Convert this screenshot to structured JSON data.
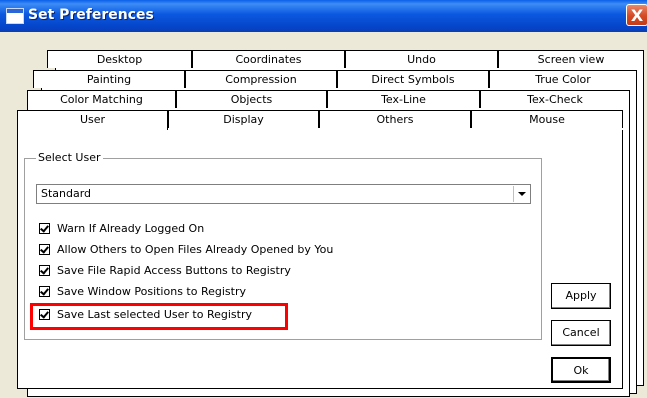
{
  "window": {
    "title": "Set Preferences",
    "close_glyph": "X",
    "icon": "window-icon"
  },
  "tabs": {
    "row1": [
      "Desktop",
      "Coordinates",
      "Undo",
      "Screen view"
    ],
    "row2": [
      "Painting",
      "Compression",
      "Direct Symbols",
      "True Color"
    ],
    "row3": [
      "Color Matching",
      "Objects",
      "Tex-Line",
      "Tex-Check"
    ],
    "row4": [
      "User",
      "Display",
      "Others",
      "Mouse"
    ],
    "active": "User"
  },
  "user_page": {
    "group_label": "Select User",
    "select": {
      "value": "Standard"
    },
    "checkboxes": [
      {
        "label": "Warn If Already Logged On",
        "checked": true
      },
      {
        "label": "Allow Others to Open Files Already Opened by You",
        "checked": true
      },
      {
        "label": "Save File Rapid Access Buttons to Registry",
        "checked": true
      },
      {
        "label": "Save Window Positions to Registry",
        "checked": true
      },
      {
        "label": "Save Last selected User to Registry",
        "checked": true
      }
    ]
  },
  "buttons": {
    "apply": "Apply",
    "cancel": "Cancel",
    "ok": "Ok"
  },
  "highlight_color": "#ff0000"
}
